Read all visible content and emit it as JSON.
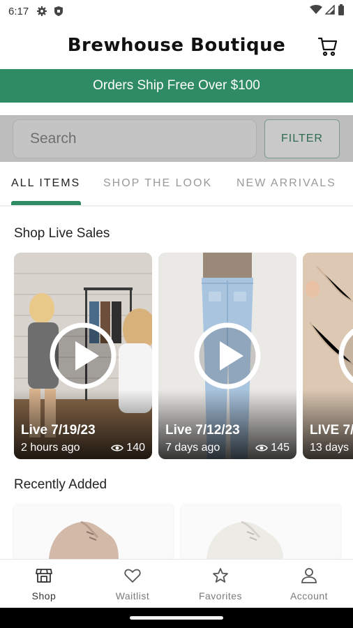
{
  "status_bar": {
    "time": "6:17"
  },
  "app": {
    "title": "Brewhouse Boutique"
  },
  "banner": {
    "text": "Orders Ship Free Over $100"
  },
  "search": {
    "placeholder": "Search",
    "filter_label": "FILTER"
  },
  "tabs": [
    {
      "label": "ALL ITEMS",
      "active": true
    },
    {
      "label": "SHOP THE LOOK",
      "active": false
    },
    {
      "label": "NEW ARRIVALS",
      "active": false
    }
  ],
  "live_sales": {
    "title": "Shop Live Sales",
    "cards": [
      {
        "label": "Live 7/19/23",
        "ago": "2 hours ago",
        "views": "140"
      },
      {
        "label": "Live 7/12/23",
        "ago": "7 days ago",
        "views": "145"
      },
      {
        "label": "LIVE 7/",
        "ago": "13 days",
        "views": ""
      }
    ]
  },
  "recently_added": {
    "title": "Recently Added"
  },
  "bottom_nav": [
    {
      "label": "Shop",
      "icon": "storefront-icon",
      "active": true
    },
    {
      "label": "Waitlist",
      "icon": "heart-icon",
      "active": false
    },
    {
      "label": "Favorites",
      "icon": "star-icon",
      "active": false
    },
    {
      "label": "Account",
      "icon": "person-icon",
      "active": false
    }
  ],
  "colors": {
    "brand_green": "#2e8b63",
    "search_bg": "#bdbdbd"
  }
}
